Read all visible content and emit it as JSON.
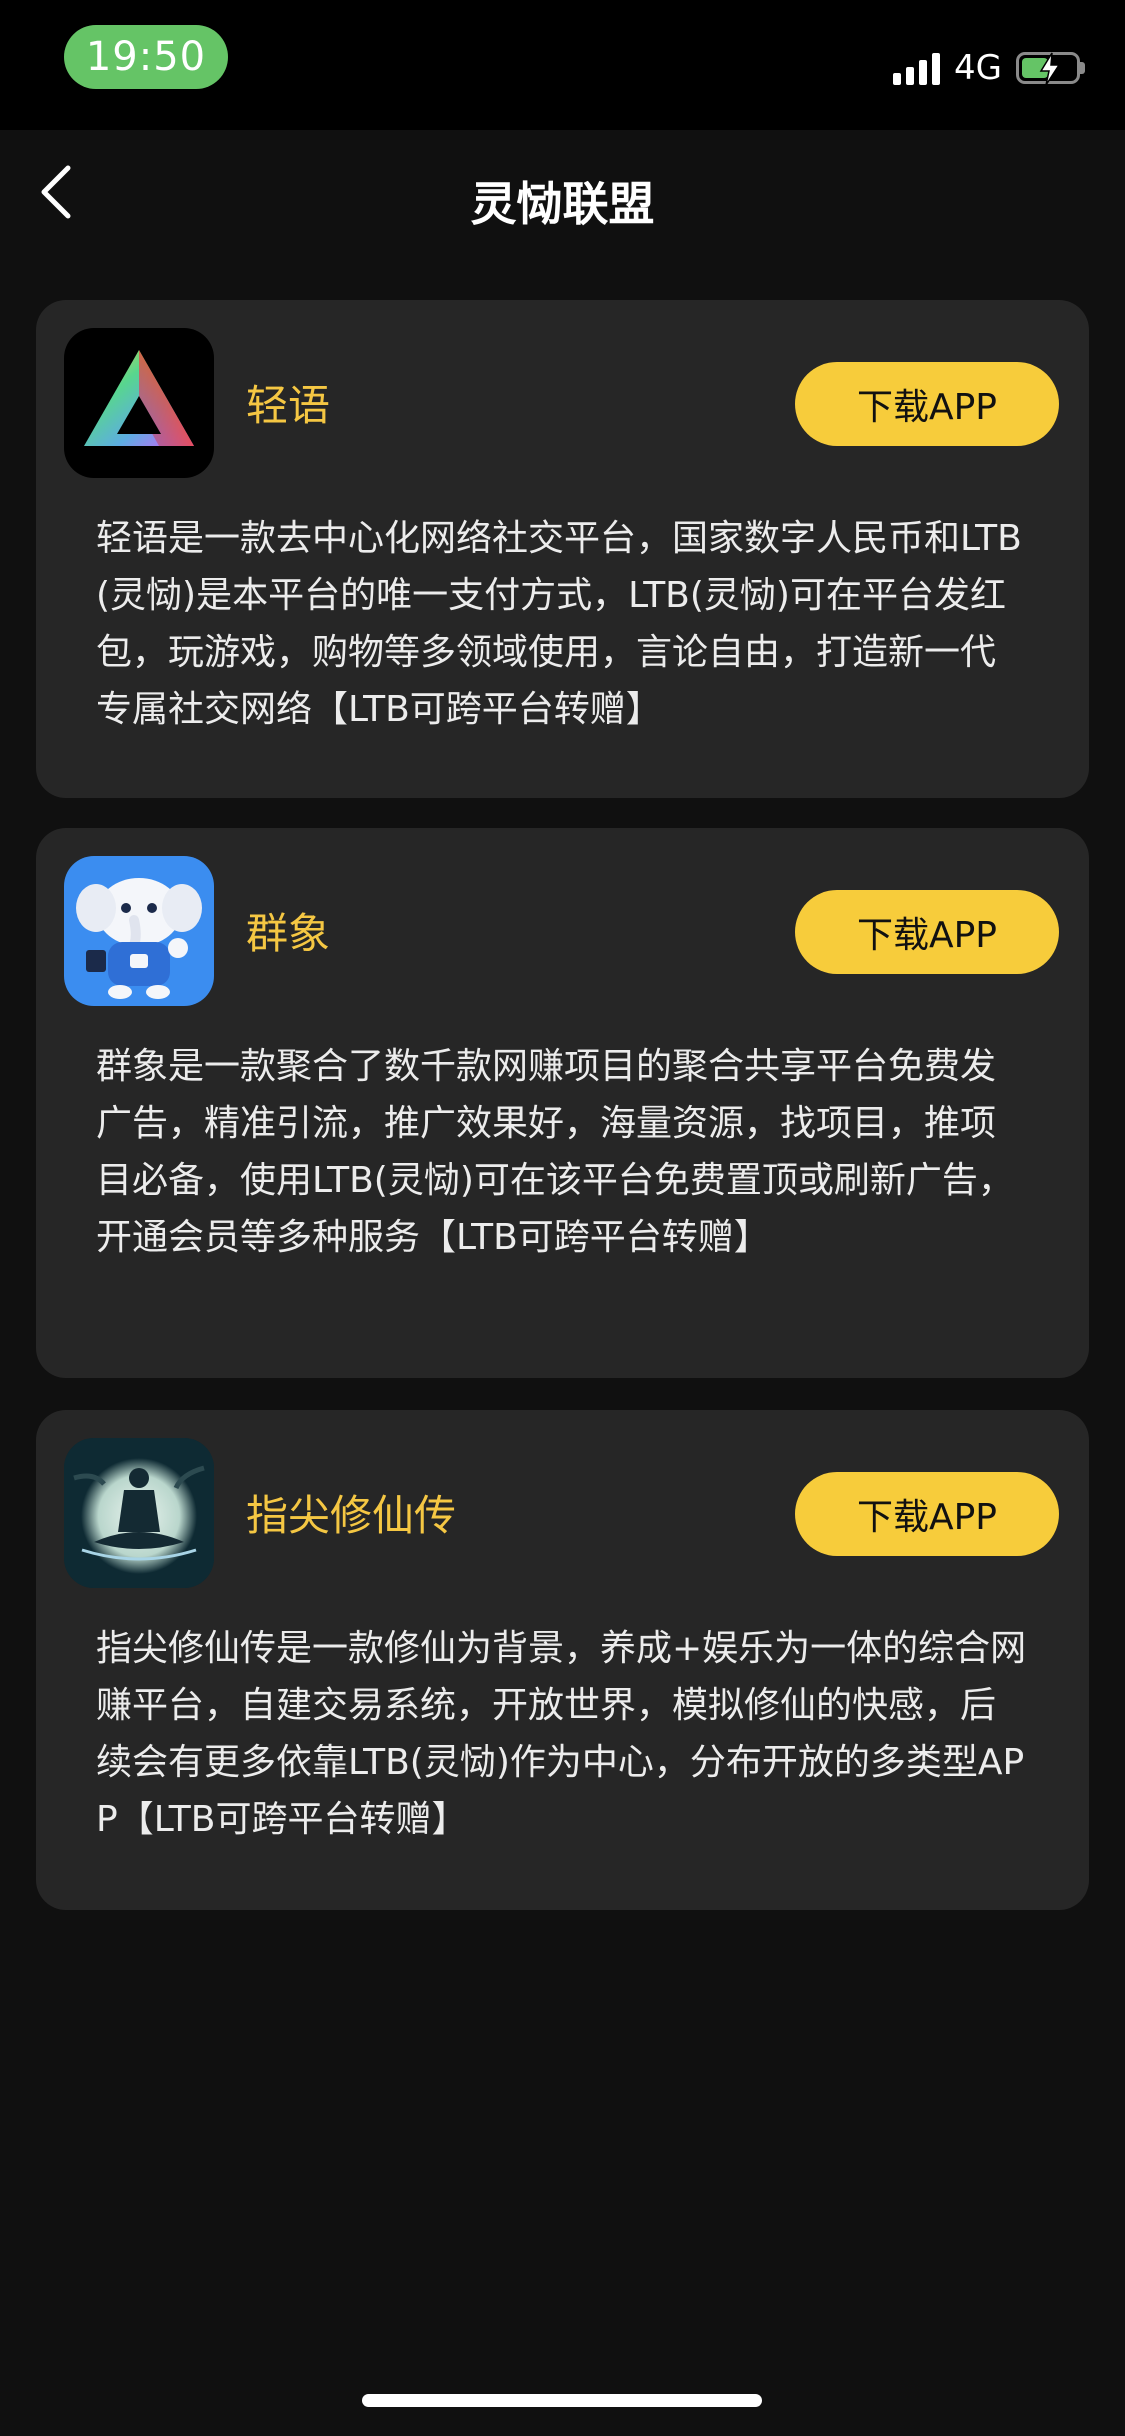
{
  "status": {
    "time": "19:50",
    "network": "4G"
  },
  "header": {
    "title": "灵恸联盟"
  },
  "apps": [
    {
      "name": "轻语",
      "button": "下载APP",
      "icon": "prism-triangle-icon",
      "description": "轻语是一款去中心化网络社交平台，国家数字人民币和LTB(灵恸)是本平台的唯一支付方式，LTB(灵恸)可在平台发红包，玩游戏，购物等多领域使用，言论自由，打造新一代专属社交网络【LTB可跨平台转赠】"
    },
    {
      "name": "群象",
      "button": "下载APP",
      "icon": "elephant-mascot-icon",
      "description": "群象是一款聚合了数千款网赚项目的聚合共享平台免费发广告，精准引流，推广效果好，海量资源，找项目，推项目必备，使用LTB(灵恸)可在该平台免费置顶或刷新广告，开通会员等多种服务【LTB可跨平台转赠】"
    },
    {
      "name": "指尖修仙传",
      "button": "下载APP",
      "icon": "meditating-immortal-icon",
      "description": "指尖修仙传是一款修仙为背景，养成+娱乐为一体的综合网赚平台，自建交易系统，开放世界，模拟修仙的快感，后续会有更多依靠LTB(灵恸)作为中心，分布开放的多类型APP【LTB可跨平台转赠】"
    }
  ],
  "colors": {
    "background": "#101010",
    "card": "#262626",
    "accent": "#f7cc3b",
    "app_name": "#f5c743",
    "time_pill": "#65c466"
  }
}
